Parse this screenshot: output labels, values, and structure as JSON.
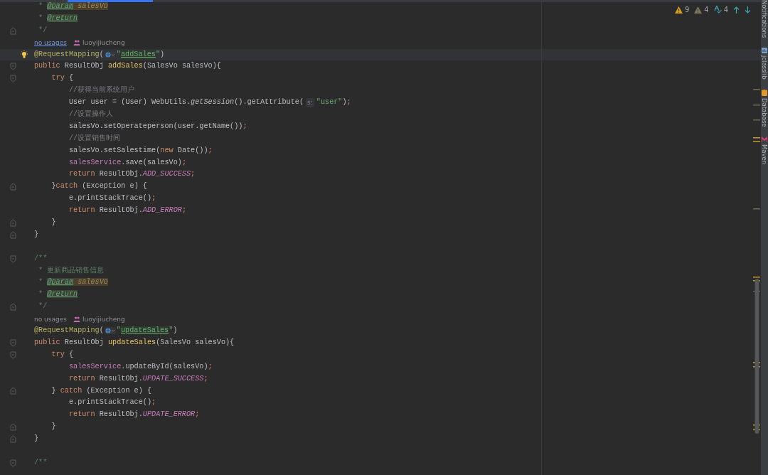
{
  "editor": {
    "lines": [
      {
        "kind": "code",
        "tokens": [
          {
            "kind": "doc",
            "text": " * "
          },
          {
            "kind": "tag",
            "text": "@param"
          },
          {
            "kind": "param",
            "text": " salesVo"
          }
        ]
      },
      {
        "kind": "code",
        "tokens": [
          {
            "kind": "doc",
            "text": " * "
          },
          {
            "kind": "tag",
            "text": "@return"
          }
        ]
      },
      {
        "kind": "code",
        "fold": {
          "kind": "end"
        },
        "tokens": [
          {
            "kind": "doc",
            "text": " */"
          }
        ]
      },
      {
        "kind": "hint",
        "usages": "no usages",
        "link": true,
        "author": "luoyijiucheng"
      },
      {
        "kind": "code",
        "current": true,
        "bulb": true,
        "tokens": [
          {
            "kind": "ann",
            "text": "@RequestMapping"
          },
          {
            "kind": "plain",
            "text": "("
          },
          {
            "kind": "globe"
          },
          {
            "kind": "str",
            "text": "\""
          },
          {
            "kind": "strlink",
            "text": "addSales"
          },
          {
            "kind": "str",
            "text": "\""
          },
          {
            "kind": "plain",
            "text": ")"
          }
        ]
      },
      {
        "kind": "code",
        "fold": {
          "kind": "start"
        },
        "tokens": [
          {
            "kind": "kw",
            "text": "public "
          },
          {
            "kind": "plain",
            "text": "ResultObj "
          },
          {
            "kind": "decl",
            "text": "addSales"
          },
          {
            "kind": "plain",
            "text": "(SalesVo salesVo){"
          }
        ]
      },
      {
        "kind": "code",
        "fold": {
          "kind": "start"
        },
        "tokens": [
          {
            "kind": "kw",
            "text": "    try "
          },
          {
            "kind": "plain",
            "text": "{"
          }
        ]
      },
      {
        "kind": "code",
        "tokens": [
          {
            "kind": "cmt",
            "text": "        //获得当前系统用户"
          }
        ]
      },
      {
        "kind": "code",
        "tokens": [
          {
            "kind": "plain",
            "text": "        User user = (User) WebUtils."
          },
          {
            "kind": "static",
            "text": "getSession"
          },
          {
            "kind": "plain",
            "text": "().getAttribute("
          },
          {
            "kind": "inlay",
            "text": "s:"
          },
          {
            "kind": "str",
            "text": "\"user\""
          },
          {
            "kind": "plain",
            "text": ")"
          },
          {
            "kind": "kw",
            "text": ";"
          }
        ]
      },
      {
        "kind": "code",
        "tokens": [
          {
            "kind": "cmt",
            "text": "        //设置操作人"
          }
        ]
      },
      {
        "kind": "code",
        "tokens": [
          {
            "kind": "plain",
            "text": "        salesVo.setOperateperson(user.getName())"
          },
          {
            "kind": "kw",
            "text": ";"
          }
        ]
      },
      {
        "kind": "code",
        "tokens": [
          {
            "kind": "cmt",
            "text": "        //设置销售时间"
          }
        ]
      },
      {
        "kind": "code",
        "tokens": [
          {
            "kind": "plain",
            "text": "        salesVo.setSalestime("
          },
          {
            "kind": "kw",
            "text": "new "
          },
          {
            "kind": "plain",
            "text": "Date())"
          },
          {
            "kind": "kw",
            "text": ";"
          }
        ]
      },
      {
        "kind": "code",
        "tokens": [
          {
            "kind": "field",
            "text": "        salesService"
          },
          {
            "kind": "plain",
            "text": ".save(salesVo)"
          },
          {
            "kind": "kw",
            "text": ";"
          }
        ]
      },
      {
        "kind": "code",
        "tokens": [
          {
            "kind": "kw",
            "text": "        return "
          },
          {
            "kind": "plain",
            "text": "ResultObj."
          },
          {
            "kind": "const",
            "text": "ADD_SUCCESS"
          },
          {
            "kind": "kw",
            "text": ";"
          }
        ]
      },
      {
        "kind": "code",
        "fold": {
          "kind": "end"
        },
        "tokens": [
          {
            "kind": "plain",
            "text": "    }"
          },
          {
            "kind": "kw",
            "text": "catch "
          },
          {
            "kind": "plain",
            "text": "(Exception e) {"
          }
        ]
      },
      {
        "kind": "code",
        "tokens": [
          {
            "kind": "plain",
            "text": "        e.printStackTrace()"
          },
          {
            "kind": "kw",
            "text": ";"
          }
        ]
      },
      {
        "kind": "code",
        "tokens": [
          {
            "kind": "kw",
            "text": "        return "
          },
          {
            "kind": "plain",
            "text": "ResultObj."
          },
          {
            "kind": "const",
            "text": "ADD_ERROR"
          },
          {
            "kind": "kw",
            "text": ";"
          }
        ]
      },
      {
        "kind": "code",
        "fold": {
          "kind": "end"
        },
        "tokens": [
          {
            "kind": "plain",
            "text": "    }"
          }
        ]
      },
      {
        "kind": "code",
        "fold": {
          "kind": "end"
        },
        "tokens": [
          {
            "kind": "plain",
            "text": "}"
          }
        ]
      },
      {
        "kind": "blank"
      },
      {
        "kind": "code",
        "fold": {
          "kind": "start"
        },
        "tokens": [
          {
            "kind": "doc",
            "text": "/**"
          }
        ]
      },
      {
        "kind": "code",
        "tokens": [
          {
            "kind": "doc",
            "text": " * 更新商品销售信息"
          }
        ]
      },
      {
        "kind": "code",
        "tokens": [
          {
            "kind": "doc",
            "text": " * "
          },
          {
            "kind": "tag",
            "text": "@param"
          },
          {
            "kind": "param",
            "text": " salesVo"
          }
        ]
      },
      {
        "kind": "code",
        "tokens": [
          {
            "kind": "doc",
            "text": " * "
          },
          {
            "kind": "tag",
            "text": "@return"
          }
        ]
      },
      {
        "kind": "code",
        "fold": {
          "kind": "end"
        },
        "tokens": [
          {
            "kind": "doc",
            "text": " */"
          }
        ]
      },
      {
        "kind": "hint",
        "usages": "no usages",
        "link": false,
        "author": "luoyijiucheng"
      },
      {
        "kind": "code",
        "tokens": [
          {
            "kind": "ann",
            "text": "@RequestMapping"
          },
          {
            "kind": "plain",
            "text": "("
          },
          {
            "kind": "globe"
          },
          {
            "kind": "str",
            "text": "\""
          },
          {
            "kind": "strlink",
            "text": "updateSales"
          },
          {
            "kind": "str",
            "text": "\""
          },
          {
            "kind": "plain",
            "text": ")"
          }
        ]
      },
      {
        "kind": "code",
        "fold": {
          "kind": "start"
        },
        "tokens": [
          {
            "kind": "kw",
            "text": "public "
          },
          {
            "kind": "plain",
            "text": "ResultObj "
          },
          {
            "kind": "decl",
            "text": "updateSales"
          },
          {
            "kind": "plain",
            "text": "(SalesVo salesVo){"
          }
        ]
      },
      {
        "kind": "code",
        "fold": {
          "kind": "start"
        },
        "tokens": [
          {
            "kind": "kw",
            "text": "    try "
          },
          {
            "kind": "plain",
            "text": "{"
          }
        ]
      },
      {
        "kind": "code",
        "tokens": [
          {
            "kind": "field",
            "text": "        salesService"
          },
          {
            "kind": "plain",
            "text": ".updateById(salesVo)"
          },
          {
            "kind": "kw",
            "text": ";"
          }
        ]
      },
      {
        "kind": "code",
        "tokens": [
          {
            "kind": "kw",
            "text": "        return "
          },
          {
            "kind": "plain",
            "text": "ResultObj."
          },
          {
            "kind": "const",
            "text": "UPDATE_SUCCESS"
          },
          {
            "kind": "kw",
            "text": ";"
          }
        ]
      },
      {
        "kind": "code",
        "fold": {
          "kind": "end"
        },
        "tokens": [
          {
            "kind": "plain",
            "text": "    } "
          },
          {
            "kind": "kw",
            "text": "catch "
          },
          {
            "kind": "plain",
            "text": "(Exception e) {"
          }
        ]
      },
      {
        "kind": "code",
        "tokens": [
          {
            "kind": "plain",
            "text": "        e.printStackTrace()"
          },
          {
            "kind": "kw",
            "text": ";"
          }
        ]
      },
      {
        "kind": "code",
        "tokens": [
          {
            "kind": "kw",
            "text": "        return "
          },
          {
            "kind": "plain",
            "text": "ResultObj."
          },
          {
            "kind": "const",
            "text": "UPDATE_ERROR"
          },
          {
            "kind": "kw",
            "text": ";"
          }
        ]
      },
      {
        "kind": "code",
        "fold": {
          "kind": "end"
        },
        "tokens": [
          {
            "kind": "plain",
            "text": "    }"
          }
        ]
      },
      {
        "kind": "code",
        "fold": {
          "kind": "end"
        },
        "tokens": [
          {
            "kind": "plain",
            "text": "}"
          }
        ]
      },
      {
        "kind": "blank"
      },
      {
        "kind": "code",
        "fold": {
          "kind": "start"
        },
        "tokens": [
          {
            "kind": "doc",
            "text": "/**"
          }
        ]
      }
    ]
  },
  "inspections": [
    {
      "kind": "warning",
      "count": "9"
    },
    {
      "kind": "weak",
      "count": "4"
    },
    {
      "kind": "typo",
      "count": "4"
    }
  ],
  "tool_windows": [
    {
      "kind": "notifications",
      "label": "Notifications"
    },
    {
      "kind": "jclasslib",
      "label": "jclasslib"
    },
    {
      "kind": "database",
      "label": "Database"
    },
    {
      "kind": "maven",
      "label": "Maven"
    }
  ]
}
